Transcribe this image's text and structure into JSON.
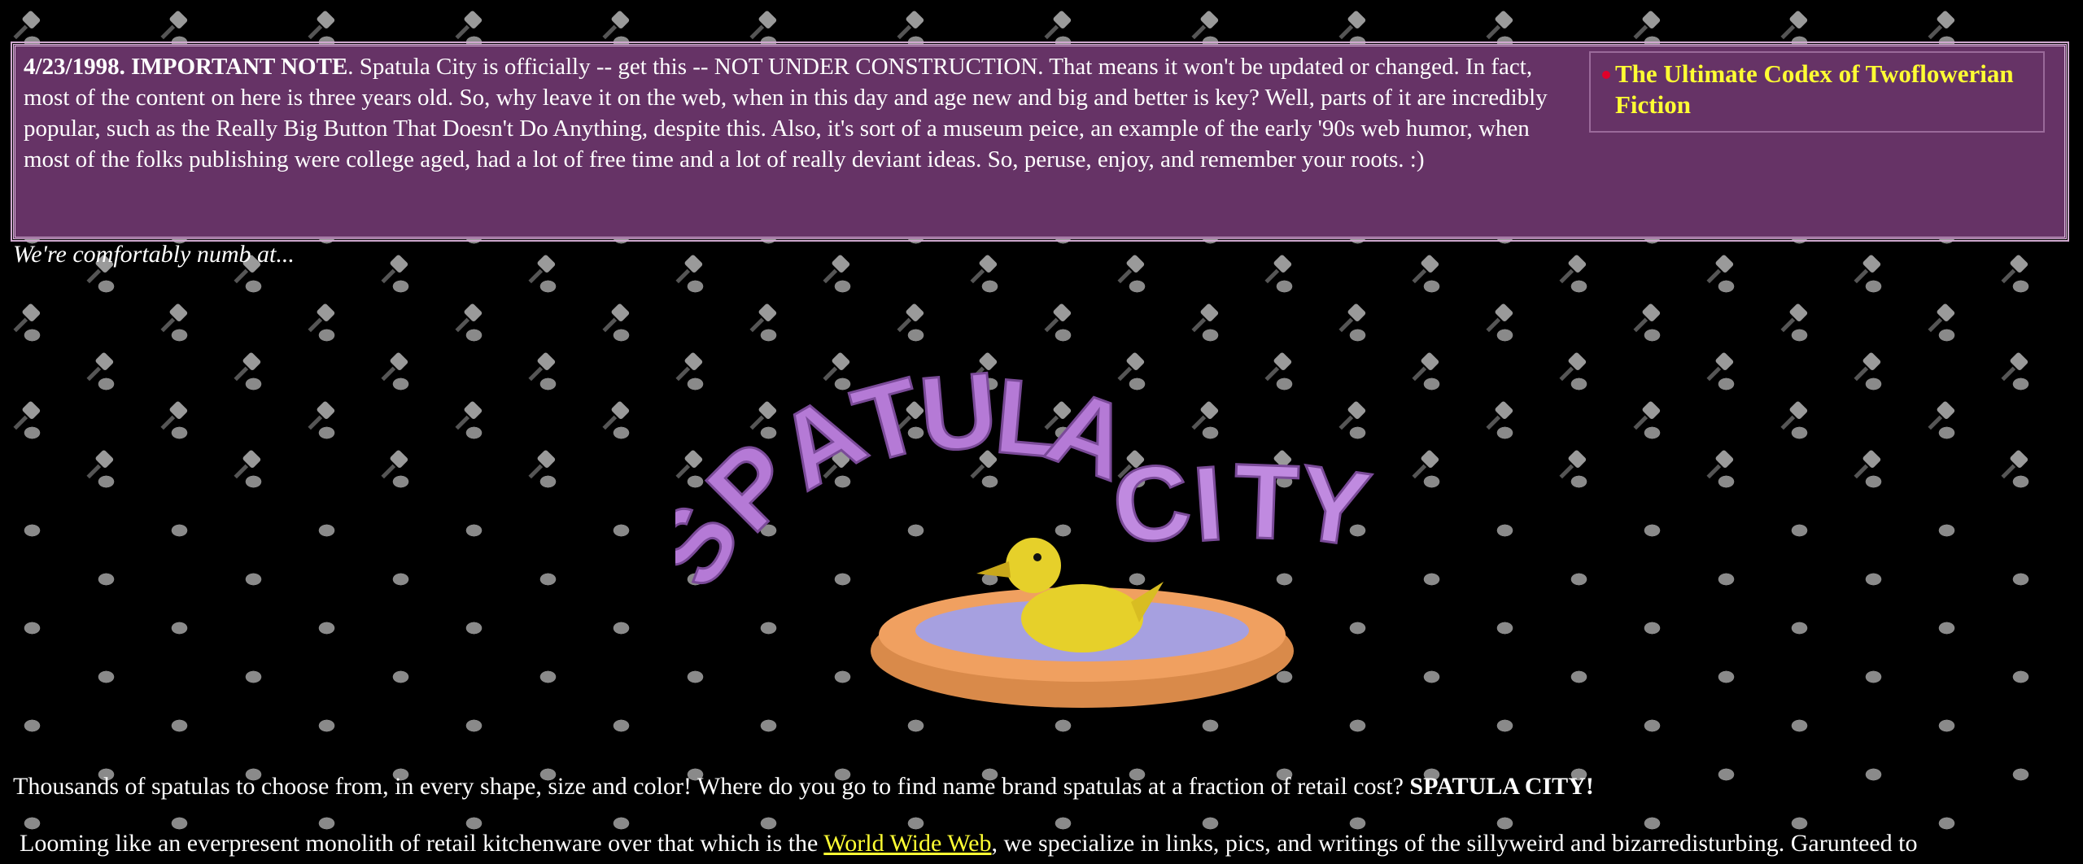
{
  "note": {
    "date_heading": "4/23/1998. IMPORTANT NOTE",
    "body": ". Spatula City is officially -- get this -- NOT UNDER CONSTRUCTION.  That means it won't be updated or changed.  In fact, most of the content on here is three years old.  So, why leave it on the web, when in this day and age new and big and better is key? Well, parts of it are incredibly popular, such as the Really Big Button That Doesn't Do Anything, despite this.  Also, it's sort of a museum peice, an example of the early '90s web humor, when most of the folks publishing were college aged, had a lot of free time and a lot of really deviant ideas.  So, peruse, enjoy, and remember your roots. :)"
  },
  "sidebar": {
    "codex_link": "The Ultimate Codex of Twoflowerian Fiction"
  },
  "tagline": "We're comfortably numb at...",
  "logo": {
    "word1": "SPATULA",
    "word2": "CITY"
  },
  "intro": {
    "text": "Thousands of spatulas to choose from, in every shape, size and color! Where do you go to find name brand spatulas at a fraction of retail cost? ",
    "bold": "SPATULA CITY!"
  },
  "para2": {
    "before": "Looming like an everpresent monolith of retail kitchenware over that which is the ",
    "link": "World Wide Web",
    "after": ", we specialize in links, pics, and writings of the sillyweird and bizarredisturbing. Garunteed to"
  },
  "colors": {
    "box_bg": "#663366",
    "link_yellow": "#ffff33",
    "logo_purple": "#b57ad6"
  }
}
